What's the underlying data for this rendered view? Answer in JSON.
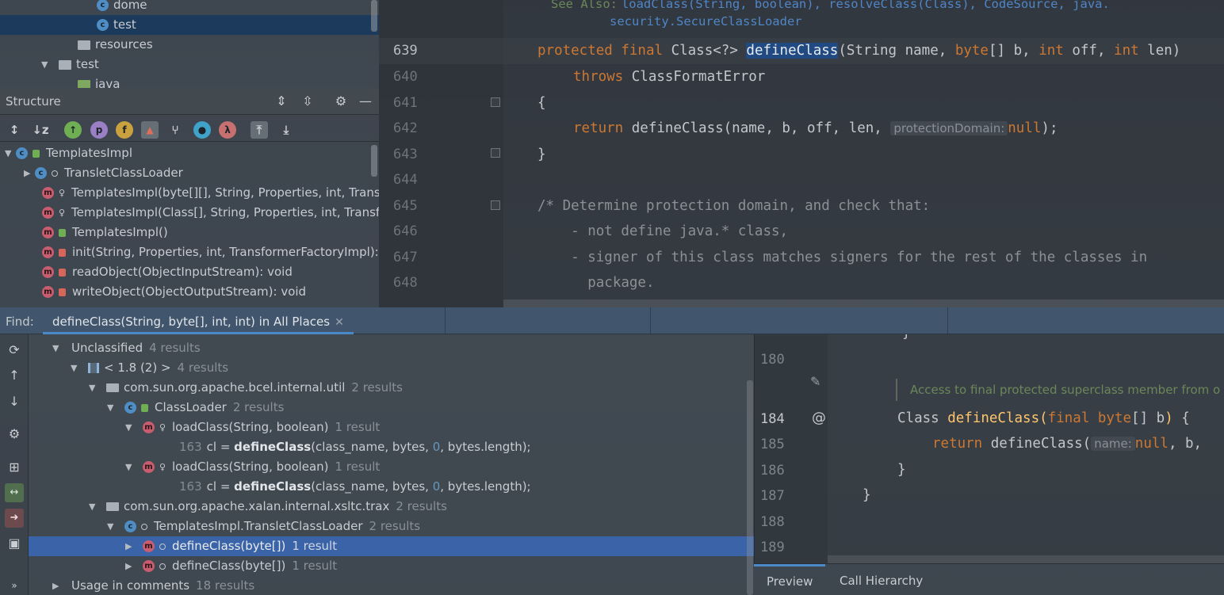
{
  "project_tree": {
    "items": [
      {
        "label": "dome",
        "icon": "class-icon"
      },
      {
        "label": "test",
        "icon": "class-icon",
        "selected": true
      },
      {
        "label": "resources",
        "icon": "resources-folder-icon"
      },
      {
        "label": "test",
        "icon": "folder-icon"
      },
      {
        "label": "java",
        "icon": "source-folder-icon"
      }
    ]
  },
  "structure": {
    "title": "Structure",
    "toolbar": [
      "sort-visibility",
      "sort-alpha",
      "show-inherited",
      "show-properties",
      "show-fields",
      "show-non-public",
      "show-anonymous",
      "show-lambdas",
      "show-lambda",
      "autoscroll-to-source",
      "autoscroll-from-source"
    ],
    "tree": [
      {
        "label": "TemplatesImpl",
        "kind": "class"
      },
      {
        "label": "TransletClassLoader",
        "kind": "class"
      },
      {
        "label": "TemplatesImpl(byte[][], String, Properties, int, Transf",
        "kind": "method",
        "access": "package"
      },
      {
        "label": "TemplatesImpl(Class[], String, Properties, int, Transfo",
        "kind": "method",
        "access": "package"
      },
      {
        "label": "TemplatesImpl()",
        "kind": "method",
        "access": "public"
      },
      {
        "label": "init(String, Properties, int, TransformerFactoryImpl): v",
        "kind": "method",
        "access": "private"
      },
      {
        "label": "readObject(ObjectInputStream): void",
        "kind": "method",
        "access": "private"
      },
      {
        "label": "writeObject(ObjectOutputStream): void",
        "kind": "method",
        "access": "private"
      }
    ]
  },
  "editor": {
    "see_also_label": "See Also:",
    "see_also_line1": "loadClass(String, boolean), resolveClass(Class), CodeSource, java.",
    "see_also_line2": "security.SecureClassLoader",
    "lines": [
      {
        "num": "639",
        "current": true
      },
      {
        "num": "640"
      },
      {
        "num": "641"
      },
      {
        "num": "642"
      },
      {
        "num": "643"
      },
      {
        "num": "644"
      },
      {
        "num": "645"
      },
      {
        "num": "646"
      },
      {
        "num": "647"
      },
      {
        "num": "648"
      }
    ],
    "code": {
      "l639_kw": "protected final ",
      "l639_type": "Class<?> ",
      "l639_name": "defineClass",
      "l639_p1": "(String name, ",
      "l639_kw2": "byte",
      "l639_p2": "[] b, ",
      "l639_kw3": "int",
      "l639_p3": " off, ",
      "l639_kw4": "int",
      "l639_p4": " len)",
      "l640_kw": "throws",
      "l640_rest": " ClassFormatError",
      "l641": "{",
      "l642_kw": "return",
      "l642_call": " defineClass(name, b, off, len, ",
      "l642_hint": "protectionDomain:",
      "l642_null": "null",
      "l642_end": ");",
      "l643": "}",
      "l645": "/* Determine protection domain, and check that:",
      "l646": "    - not define java.* class,",
      "l647": "    - signer of this class matches signers for the rest of the classes in",
      "l648": "      package."
    }
  },
  "find": {
    "label": "Find:",
    "tab_label": "defineClass(String, byte[], int, int) in All Places",
    "side_buttons": [
      "rerun-icon",
      "previous-occurrence-icon",
      "next-occurrence-icon",
      "settings-icon",
      "group-icon",
      "navigate-icon",
      "export-icon",
      "module-icon"
    ],
    "results": [
      {
        "indent": 0,
        "text": "Unclassified",
        "count": "4 results",
        "type": "group"
      },
      {
        "indent": 1,
        "text": "< 1.8 (2) >",
        "count": "4 results",
        "type": "library"
      },
      {
        "indent": 2,
        "text": "com.sun.org.apache.bcel.internal.util",
        "count": "2 results",
        "type": "package"
      },
      {
        "indent": 3,
        "text": "ClassLoader",
        "count": "2 results",
        "type": "class"
      },
      {
        "indent": 4,
        "text": "loadClass(String, boolean)",
        "count": "1 result",
        "type": "method"
      },
      {
        "indent": 5,
        "line": "163",
        "pre": "cl = ",
        "bold": "defineClass",
        "mid": "(class_name, bytes, ",
        "num": "0",
        "post": ", bytes.length);",
        "type": "usage"
      },
      {
        "indent": 4,
        "text": "loadClass(String, boolean)",
        "count": "1 result",
        "type": "method"
      },
      {
        "indent": 5,
        "line": "163",
        "pre": "cl = ",
        "bold": "defineClass",
        "mid": "(class_name, bytes, ",
        "num": "0",
        "post": ", bytes.length);",
        "type": "usage"
      },
      {
        "indent": 2,
        "text": "com.sun.org.apache.xalan.internal.xsltc.trax",
        "count": "2 results",
        "type": "package"
      },
      {
        "indent": 3,
        "text": "TemplatesImpl.TransletClassLoader",
        "count": "2 results",
        "type": "class"
      },
      {
        "indent": 4,
        "text": "defineClass(byte[])",
        "count": "1 result",
        "type": "method",
        "selected": true
      },
      {
        "indent": 4,
        "text": "defineClass(byte[])",
        "count": "1 result",
        "type": "method"
      },
      {
        "indent": 0,
        "text": "Usage in comments",
        "count": "18 results",
        "type": "group"
      }
    ]
  },
  "preview": {
    "lines": [
      "180",
      "184",
      "185",
      "186",
      "187",
      "188",
      "189"
    ],
    "annotation_marker": "@",
    "inlay_note": "Access to final protected superclass member from o",
    "code": {
      "l184_type": "Class ",
      "l184_name": "defineClass",
      "l184_paren": "(",
      "l184_kw": "final byte",
      "l184_rest": "[] b",
      "l184_paren2": ")",
      "l184_brace": " {",
      "l185_kw": "return",
      "l185_call": " defineClass(",
      "l185_hint": "name:",
      "l185_null": "null",
      "l185_end": ", b,",
      "l177": "}",
      "l186": "}",
      "l187": "}"
    },
    "tabs": [
      "Preview",
      "Call Hierarchy"
    ]
  }
}
